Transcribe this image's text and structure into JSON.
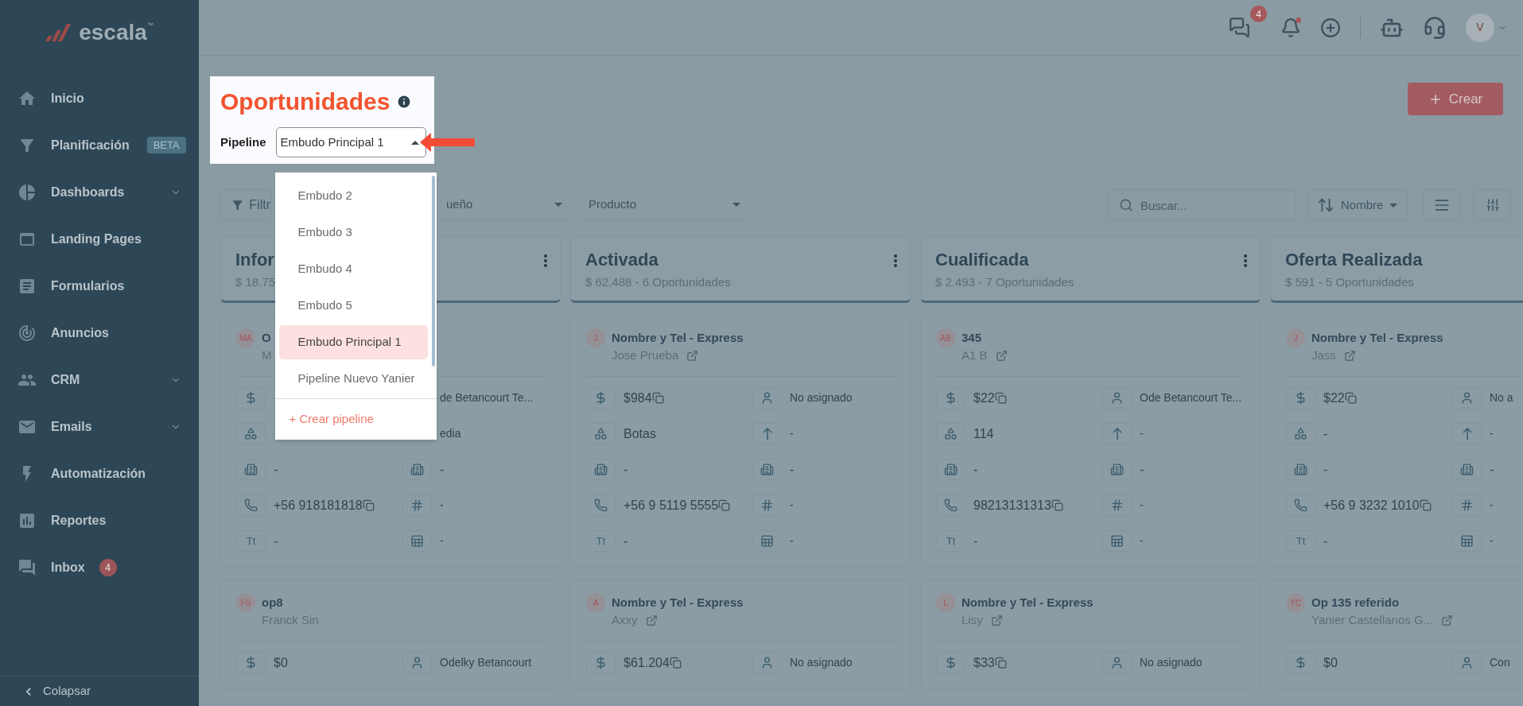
{
  "logo": {
    "text": "escala",
    "mark": "™"
  },
  "sidebar": {
    "items": [
      {
        "label": "Inicio",
        "expandable": false
      },
      {
        "label": "Planificación",
        "badge": {
          "kind": "tag",
          "text": "BETA"
        },
        "expandable": false
      },
      {
        "label": "Dashboards",
        "expandable": true
      },
      {
        "label": "Landing Pages",
        "expandable": false
      },
      {
        "label": "Formularios",
        "expandable": false
      },
      {
        "label": "Anuncios",
        "expandable": false
      },
      {
        "label": "CRM",
        "expandable": true
      },
      {
        "label": "Emails",
        "expandable": true
      },
      {
        "label": "Automatización",
        "expandable": false
      },
      {
        "label": "Reportes",
        "expandable": false
      },
      {
        "label": "Inbox",
        "badge": {
          "kind": "count",
          "text": "4"
        },
        "expandable": false
      }
    ],
    "collapse": "Colapsar"
  },
  "header": {
    "chat_count": "4",
    "bell_unread": true,
    "avatar": "V"
  },
  "page": {
    "title": "Oportunidades",
    "create_button": "Crear",
    "pipeline": {
      "label": "Pipeline",
      "value": "Embudo Principal 1",
      "expanded": true,
      "options": [
        {
          "label": "Embudo 2",
          "selected": false
        },
        {
          "label": "Embudo 3",
          "selected": false
        },
        {
          "label": "Embudo 4",
          "selected": false
        },
        {
          "label": "Embudo 5",
          "selected": false
        },
        {
          "label": "Embudo Principal 1",
          "selected": true
        },
        {
          "label": "Pipeline Nuevo Yanier",
          "selected": false
        }
      ],
      "create": "+ Crear pipeline"
    }
  },
  "toolbar": {
    "filter": "Filtr",
    "owner": "ueño",
    "product": "Producto",
    "search": {
      "placeholder": "Buscar..."
    },
    "sort": "Nombre"
  },
  "columns": [
    {
      "title": "Infor",
      "summary": "$ 18.75",
      "cards": [
        {
          "avatar": "MA",
          "title": "O",
          "subtitle": "M",
          "link": false,
          "fields": [
            {
              "kind": "amount",
              "copy": false
            },
            {
              "kind": "owner",
              "value": "de Betancourt Te...",
              "boxed": false
            },
            {
              "kind": "product"
            },
            {
              "kind": "priority",
              "value": "edia",
              "boxed": false
            },
            {
              "kind": "company",
              "value": "-"
            },
            {
              "kind": "company",
              "value": "-"
            },
            {
              "kind": "phone",
              "value": "+56 918181818",
              "copy": true
            },
            {
              "kind": "number",
              "value": "-"
            },
            {
              "kind": "text",
              "badge": "Tt",
              "value": "-"
            },
            {
              "kind": "table",
              "value": "-"
            }
          ]
        },
        {
          "avatar": "FS",
          "title": "op8",
          "subtitle": "Franck Sin",
          "link": false,
          "fields": [
            {
              "kind": "amount",
              "value": "$0",
              "copy": false
            },
            {
              "kind": "owner",
              "value": "Odelky Betancourt"
            }
          ]
        }
      ]
    },
    {
      "title": "Activada",
      "summary": "$ 62.488 - 6 Oportunidades",
      "cards": [
        {
          "avatar": "J",
          "title": "Nombre y Tel - Express",
          "subtitle": "Jose Prueba",
          "link": true,
          "fields": [
            {
              "kind": "amount",
              "value": "$984",
              "copy": true
            },
            {
              "kind": "owner",
              "value": "No asignado"
            },
            {
              "kind": "product",
              "value": "Botas"
            },
            {
              "kind": "priority",
              "value": "-"
            },
            {
              "kind": "company",
              "value": "-"
            },
            {
              "kind": "company",
              "value": "-"
            },
            {
              "kind": "phone",
              "value": "+56 9 5119 5555",
              "copy": true
            },
            {
              "kind": "number",
              "value": "-"
            },
            {
              "kind": "text",
              "badge": "Tt",
              "value": "-"
            },
            {
              "kind": "table",
              "value": "-"
            }
          ]
        },
        {
          "avatar": "A",
          "title": "Nombre y Tel - Express",
          "subtitle": "Axxy",
          "link": true,
          "fields": [
            {
              "kind": "amount",
              "value": "$61.204",
              "copy": true
            },
            {
              "kind": "owner",
              "value": "No asignado"
            }
          ]
        }
      ]
    },
    {
      "title": "Cualificada",
      "summary": "$ 2.493 - 7 Oportunidades",
      "cards": [
        {
          "avatar": "AB",
          "title": "345",
          "subtitle": "A1 B",
          "link": true,
          "fields": [
            {
              "kind": "amount",
              "value": "$22",
              "copy": true
            },
            {
              "kind": "owner",
              "value": "Ode Betancourt Te..."
            },
            {
              "kind": "product",
              "value": "114"
            },
            {
              "kind": "priority",
              "value": "-"
            },
            {
              "kind": "company",
              "value": "-"
            },
            {
              "kind": "company",
              "value": "-"
            },
            {
              "kind": "phone",
              "value": "98213131313",
              "copy": true
            },
            {
              "kind": "number",
              "value": "-"
            },
            {
              "kind": "text",
              "badge": "Tt",
              "value": "-"
            },
            {
              "kind": "table",
              "value": "-"
            }
          ]
        },
        {
          "avatar": "L",
          "title": "Nombre y Tel - Express",
          "subtitle": "Lisy",
          "link": true,
          "fields": [
            {
              "kind": "amount",
              "value": "$33",
              "copy": true
            },
            {
              "kind": "owner",
              "value": "No asignado"
            }
          ]
        }
      ]
    },
    {
      "title": "Oferta Realizada",
      "summary": "$ 591 - 5 Oportunidades",
      "cards": [
        {
          "avatar": "J",
          "title": "Nombre y Tel - Express",
          "subtitle": "Jass",
          "link": true,
          "fields": [
            {
              "kind": "amount",
              "value": "$22",
              "copy": true
            },
            {
              "kind": "owner",
              "value": "No a"
            },
            {
              "kind": "product",
              "value": "-"
            },
            {
              "kind": "priority",
              "value": "-"
            },
            {
              "kind": "company",
              "value": "-"
            },
            {
              "kind": "company",
              "value": "-"
            },
            {
              "kind": "phone",
              "value": "+56 9 3232 1010",
              "copy": true
            },
            {
              "kind": "number",
              "value": "-"
            },
            {
              "kind": "text",
              "badge": "Tt",
              "value": "-"
            },
            {
              "kind": "table",
              "value": "-"
            }
          ]
        },
        {
          "avatar": "YC",
          "title": "Op 135 referido",
          "subtitle": "Yanier Castellanos G...",
          "link": true,
          "fields": [
            {
              "kind": "amount",
              "value": "$0",
              "copy": false
            },
            {
              "kind": "owner",
              "value": "Con"
            }
          ]
        }
      ]
    }
  ]
}
